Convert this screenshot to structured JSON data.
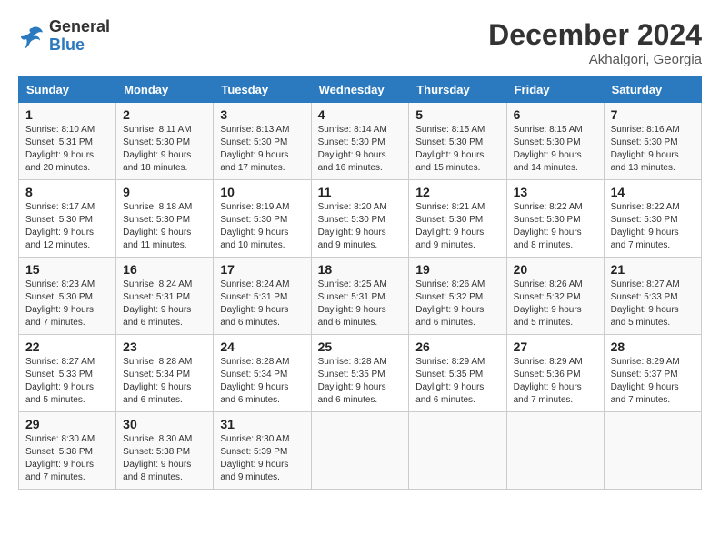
{
  "header": {
    "logo_text_general": "General",
    "logo_text_blue": "Blue",
    "month": "December 2024",
    "location": "Akhalgori, Georgia"
  },
  "calendar": {
    "days_of_week": [
      "Sunday",
      "Monday",
      "Tuesday",
      "Wednesday",
      "Thursday",
      "Friday",
      "Saturday"
    ],
    "weeks": [
      [
        {
          "day": "1",
          "info": "Sunrise: 8:10 AM\nSunset: 5:31 PM\nDaylight: 9 hours\nand 20 minutes."
        },
        {
          "day": "2",
          "info": "Sunrise: 8:11 AM\nSunset: 5:30 PM\nDaylight: 9 hours\nand 18 minutes."
        },
        {
          "day": "3",
          "info": "Sunrise: 8:13 AM\nSunset: 5:30 PM\nDaylight: 9 hours\nand 17 minutes."
        },
        {
          "day": "4",
          "info": "Sunrise: 8:14 AM\nSunset: 5:30 PM\nDaylight: 9 hours\nand 16 minutes."
        },
        {
          "day": "5",
          "info": "Sunrise: 8:15 AM\nSunset: 5:30 PM\nDaylight: 9 hours\nand 15 minutes."
        },
        {
          "day": "6",
          "info": "Sunrise: 8:15 AM\nSunset: 5:30 PM\nDaylight: 9 hours\nand 14 minutes."
        },
        {
          "day": "7",
          "info": "Sunrise: 8:16 AM\nSunset: 5:30 PM\nDaylight: 9 hours\nand 13 minutes."
        }
      ],
      [
        {
          "day": "8",
          "info": "Sunrise: 8:17 AM\nSunset: 5:30 PM\nDaylight: 9 hours\nand 12 minutes."
        },
        {
          "day": "9",
          "info": "Sunrise: 8:18 AM\nSunset: 5:30 PM\nDaylight: 9 hours\nand 11 minutes."
        },
        {
          "day": "10",
          "info": "Sunrise: 8:19 AM\nSunset: 5:30 PM\nDaylight: 9 hours\nand 10 minutes."
        },
        {
          "day": "11",
          "info": "Sunrise: 8:20 AM\nSunset: 5:30 PM\nDaylight: 9 hours\nand 9 minutes."
        },
        {
          "day": "12",
          "info": "Sunrise: 8:21 AM\nSunset: 5:30 PM\nDaylight: 9 hours\nand 9 minutes."
        },
        {
          "day": "13",
          "info": "Sunrise: 8:22 AM\nSunset: 5:30 PM\nDaylight: 9 hours\nand 8 minutes."
        },
        {
          "day": "14",
          "info": "Sunrise: 8:22 AM\nSunset: 5:30 PM\nDaylight: 9 hours\nand 7 minutes."
        }
      ],
      [
        {
          "day": "15",
          "info": "Sunrise: 8:23 AM\nSunset: 5:30 PM\nDaylight: 9 hours\nand 7 minutes."
        },
        {
          "day": "16",
          "info": "Sunrise: 8:24 AM\nSunset: 5:31 PM\nDaylight: 9 hours\nand 6 minutes."
        },
        {
          "day": "17",
          "info": "Sunrise: 8:24 AM\nSunset: 5:31 PM\nDaylight: 9 hours\nand 6 minutes."
        },
        {
          "day": "18",
          "info": "Sunrise: 8:25 AM\nSunset: 5:31 PM\nDaylight: 9 hours\nand 6 minutes."
        },
        {
          "day": "19",
          "info": "Sunrise: 8:26 AM\nSunset: 5:32 PM\nDaylight: 9 hours\nand 6 minutes."
        },
        {
          "day": "20",
          "info": "Sunrise: 8:26 AM\nSunset: 5:32 PM\nDaylight: 9 hours\nand 5 minutes."
        },
        {
          "day": "21",
          "info": "Sunrise: 8:27 AM\nSunset: 5:33 PM\nDaylight: 9 hours\nand 5 minutes."
        }
      ],
      [
        {
          "day": "22",
          "info": "Sunrise: 8:27 AM\nSunset: 5:33 PM\nDaylight: 9 hours\nand 5 minutes."
        },
        {
          "day": "23",
          "info": "Sunrise: 8:28 AM\nSunset: 5:34 PM\nDaylight: 9 hours\nand 6 minutes."
        },
        {
          "day": "24",
          "info": "Sunrise: 8:28 AM\nSunset: 5:34 PM\nDaylight: 9 hours\nand 6 minutes."
        },
        {
          "day": "25",
          "info": "Sunrise: 8:28 AM\nSunset: 5:35 PM\nDaylight: 9 hours\nand 6 minutes."
        },
        {
          "day": "26",
          "info": "Sunrise: 8:29 AM\nSunset: 5:35 PM\nDaylight: 9 hours\nand 6 minutes."
        },
        {
          "day": "27",
          "info": "Sunrise: 8:29 AM\nSunset: 5:36 PM\nDaylight: 9 hours\nand 7 minutes."
        },
        {
          "day": "28",
          "info": "Sunrise: 8:29 AM\nSunset: 5:37 PM\nDaylight: 9 hours\nand 7 minutes."
        }
      ],
      [
        {
          "day": "29",
          "info": "Sunrise: 8:30 AM\nSunset: 5:38 PM\nDaylight: 9 hours\nand 7 minutes."
        },
        {
          "day": "30",
          "info": "Sunrise: 8:30 AM\nSunset: 5:38 PM\nDaylight: 9 hours\nand 8 minutes."
        },
        {
          "day": "31",
          "info": "Sunrise: 8:30 AM\nSunset: 5:39 PM\nDaylight: 9 hours\nand 9 minutes."
        },
        {
          "day": "",
          "info": ""
        },
        {
          "day": "",
          "info": ""
        },
        {
          "day": "",
          "info": ""
        },
        {
          "day": "",
          "info": ""
        }
      ]
    ]
  }
}
